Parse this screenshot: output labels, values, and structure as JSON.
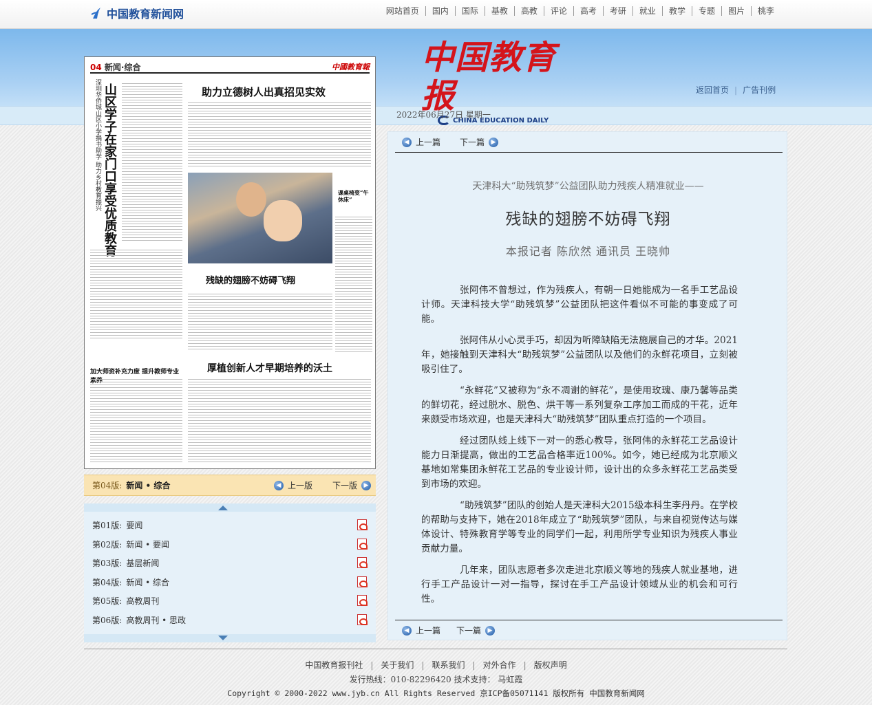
{
  "site": {
    "logo_text": "中国教育新闻网",
    "nav": [
      "网站首页",
      "国内",
      "国际",
      "基教",
      "高教",
      "评论",
      "高考",
      "考研",
      "就业",
      "教学",
      "专题",
      "图片",
      "桃李"
    ]
  },
  "masthead": {
    "cn": "中国教育报",
    "en": "CHINA EDUCATION DAILY",
    "links": [
      "返回首页",
      "广告刊例"
    ],
    "date": "2022年06月27日 星期一"
  },
  "paper_thumb": {
    "page_no": "04",
    "section": "新闻·综合",
    "mini_mast": "中國教育報",
    "vertical_headline": "山区学子在家门口享受优质教育",
    "vertical_sub": "深圳华侨城山区小学捐书助学 助力乡村教育振兴",
    "headline_top": "助力立德树人出真招见实效",
    "headline_photo": "残缺的翅膀不妨碍飞翔",
    "headline_bottom": "厚植创新人才早期培养的沃土",
    "headline_left_bottom": "加大师资补充力度 提升教师专业素养",
    "side_caption": "课桌椅变“午休床”"
  },
  "pagebar": {
    "current_label": "第04版:",
    "current_name": "新闻 • 综合",
    "prev": "上一版",
    "next": "下一版"
  },
  "pages": [
    {
      "no": "第01版:",
      "name": "要闻"
    },
    {
      "no": "第02版:",
      "name": "新闻 • 要闻"
    },
    {
      "no": "第03版:",
      "name": "基层新闻"
    },
    {
      "no": "第04版:",
      "name": "新闻 • 综合"
    },
    {
      "no": "第05版:",
      "name": "高教周刊"
    },
    {
      "no": "第06版:",
      "name": "高教周刊 • 思政"
    }
  ],
  "article": {
    "nav_prev": "上一篇",
    "nav_next": "下一篇",
    "pretitle": "天津科大“助残筑梦”公益团队助力残疾人精准就业——",
    "title": "残缺的翅膀不妨碍飞翔",
    "byline": "本报记者 陈欣然 通讯员 王晓帅",
    "paragraphs": [
      "张阿伟不曾想过，作为残疾人，有朝一日她能成为一名手工艺品设计师。天津科技大学“助残筑梦”公益团队把这件看似不可能的事变成了可能。",
      "张阿伟从小心灵手巧，却因为听障缺陷无法施展自己的才华。2021年，她接触到天津科大“助残筑梦”公益团队以及他们的永鲜花项目，立刻被吸引住了。",
      "“永鲜花”又被称为“永不凋谢的鲜花”，是使用玫瑰、康乃馨等品类的鲜切花，经过脱水、脱色、烘干等一系列复杂工序加工而成的干花，近年来颇受市场欢迎，也是天津科大“助残筑梦”团队重点打造的一个项目。",
      "经过团队线上线下一对一的悉心教导，张阿伟的永鲜花工艺品设计能力日渐提高，做出的工艺品合格率近100%。如今，她已经成为北京顺义基地如常集团永鲜花工艺品的专业设计师，设计出的众多永鲜花工艺品类受到市场的欢迎。",
      "“助残筑梦”团队的创始人是天津科大2015级本科生李丹丹。在学校的帮助与支持下，她在2018年成立了“助残筑梦”团队，与来自视觉传达与媒体设计、特殊教育学等专业的同学们一起，利用所学专业知识为残疾人事业贡献力量。",
      "几年来，团队志愿者多次走进北京顺义等地的残疾人就业基地，进行手工产品设计一对一指导，探讨在手工产品设计领域从业的机会和可行性。"
    ]
  },
  "footer": {
    "links": [
      "中国教育报刊社",
      "关于我们",
      "联系我们",
      "对外合作",
      "版权声明"
    ],
    "hotline": "发行热线：010-82296420 技术支持： 马虹霞",
    "copyright": "Copyright © 2000-2022 www.jyb.cn All Rights Reserved 京ICP备05071141 版权所有 中国教育新闻网"
  }
}
